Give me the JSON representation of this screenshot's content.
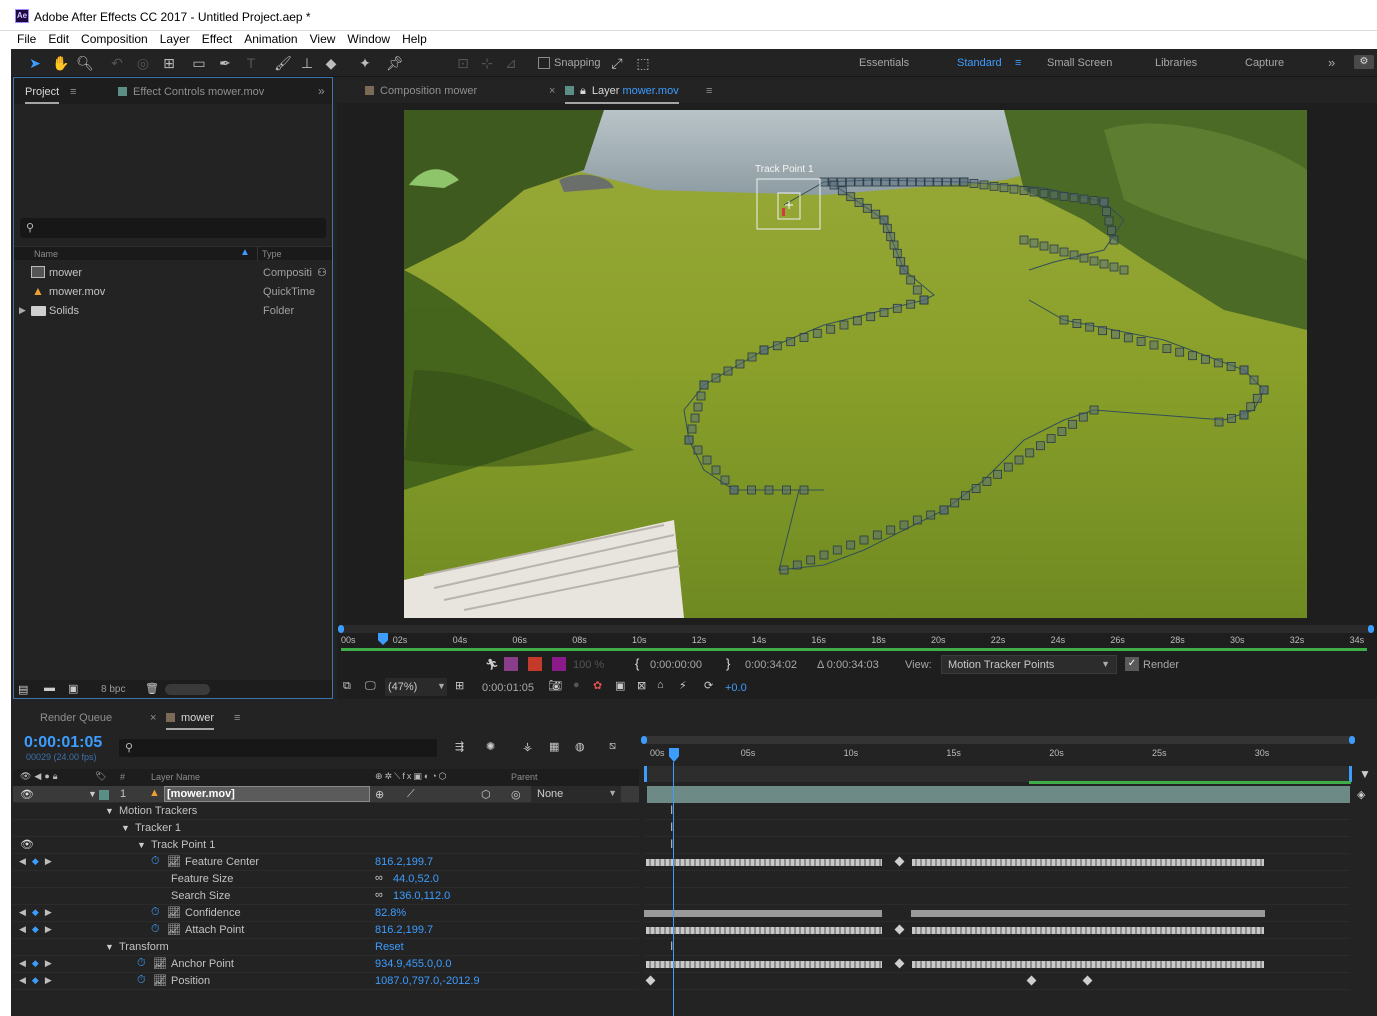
{
  "window": {
    "title": "Adobe After Effects CC 2017 - Untitled Project.aep *",
    "logo": "Ae"
  },
  "menu": [
    "File",
    "Edit",
    "Composition",
    "Layer",
    "Effect",
    "Animation",
    "View",
    "Window",
    "Help"
  ],
  "toolbar": {
    "snapping": "Snapping",
    "workspaces": [
      "Essentials",
      "Standard",
      "Small Screen",
      "Libraries",
      "Capture"
    ],
    "active_workspace": "Standard"
  },
  "project": {
    "tabs": [
      "Project",
      "Effect Controls mower.mov"
    ],
    "columns": {
      "name": "Name",
      "type": "Type"
    },
    "items": [
      {
        "name": "mower",
        "type": "Compositi",
        "icon": "composition-icon"
      },
      {
        "name": "mower.mov",
        "type": "QuickTime",
        "icon": "footage-icon"
      },
      {
        "name": "Solids",
        "type": "Folder",
        "icon": "folder-icon"
      }
    ],
    "bpc": "8 bpc"
  },
  "comp_viewer": {
    "tabs": [
      "Composition mower",
      "Layer",
      "mower.mov"
    ],
    "track_point_label": "Track Point 1",
    "ruler": [
      "00s",
      "02s",
      "04s",
      "06s",
      "08s",
      "10s",
      "12s",
      "14s",
      "16s",
      "18s",
      "20s",
      "22s",
      "24s",
      "26s",
      "28s",
      "30s",
      "32s",
      "34s"
    ],
    "in_time": "0:00:00:00",
    "out_time": "0:00:34:02",
    "duration": "Δ 0:00:34:03",
    "view_label": "View:",
    "view_value": "Motion Tracker Points",
    "render_label": "Render",
    "zoom": "(47%)",
    "current_time": "0:00:01:05",
    "exposure": "+0.0",
    "opacity_disabled": "100 %"
  },
  "timeline": {
    "tabs": [
      "Render Queue",
      "mower"
    ],
    "timecode": "0:00:01:05",
    "frame_info": "00029 (24.00 fps)",
    "col_headers": {
      "hash": "#",
      "layer_name": "Layer Name",
      "parent": "Parent"
    },
    "ruler": [
      "00s",
      "05s",
      "10s",
      "15s",
      "20s",
      "25s",
      "30s"
    ],
    "layer": {
      "index": "1",
      "name": "[mower.mov]",
      "parent": "None"
    },
    "rows": [
      {
        "label": "Motion Trackers",
        "indent": 1,
        "value": ""
      },
      {
        "label": "Tracker 1",
        "indent": 2,
        "value": ""
      },
      {
        "label": "Track Point 1",
        "indent": 3,
        "value": ""
      },
      {
        "label": "Feature Center",
        "indent": 4,
        "value": "816.2,199.7"
      },
      {
        "label": "Feature Size",
        "indent": 4,
        "value": "44.0,52.0"
      },
      {
        "label": "Search Size",
        "indent": 4,
        "value": "136.0,112.0"
      },
      {
        "label": "Confidence",
        "indent": 4,
        "value": "82.8%"
      },
      {
        "label": "Attach Point",
        "indent": 4,
        "value": "816.2,199.7"
      },
      {
        "label": "Transform",
        "indent": 1,
        "value": "Reset"
      },
      {
        "label": "Anchor Point",
        "indent": 2,
        "value": "934.9,455.0,0.0"
      },
      {
        "label": "Position",
        "indent": 2,
        "value": "1087.0,797.0,-2012.9"
      }
    ]
  },
  "colors": {
    "accent": "#3d9dff",
    "panel_bg": "#232323",
    "work_area": "#3fae49"
  }
}
